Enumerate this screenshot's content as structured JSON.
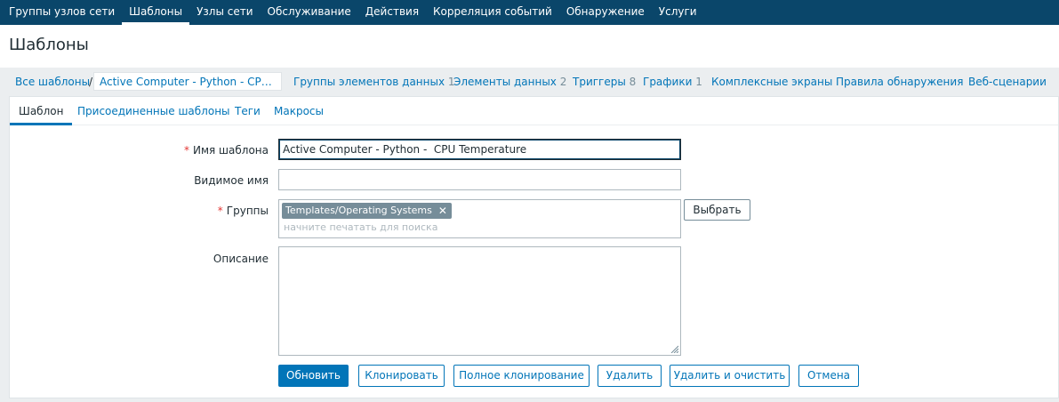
{
  "topnav": {
    "items": [
      {
        "label": "Группы узлов сети"
      },
      {
        "label": "Шаблоны"
      },
      {
        "label": "Узлы сети"
      },
      {
        "label": "Обслуживание"
      },
      {
        "label": "Действия"
      },
      {
        "label": "Корреляция событий"
      },
      {
        "label": "Обнаружение"
      },
      {
        "label": "Услуги"
      }
    ],
    "active": "Шаблоны"
  },
  "header": {
    "title": "Шаблоны"
  },
  "subnav": {
    "all_templates": "Все шаблоны",
    "separator": "/",
    "current_template": "Active Computer - Python - CPU Temperature",
    "links": [
      {
        "label": "Группы элементов данных",
        "count": "1"
      },
      {
        "label": "Элементы данных",
        "count": "2"
      },
      {
        "label": "Триггеры",
        "count": "8"
      },
      {
        "label": "Графики",
        "count": "1"
      },
      {
        "label": "Комплексные экраны",
        "count": ""
      },
      {
        "label": "Правила обнаружения",
        "count": ""
      },
      {
        "label": "Веб-сценарии",
        "count": ""
      }
    ]
  },
  "tabs": [
    {
      "label": "Шаблон"
    },
    {
      "label": "Присоединенные шаблоны"
    },
    {
      "label": "Теги"
    },
    {
      "label": "Макросы"
    }
  ],
  "form": {
    "required_mark": "*",
    "template_name_label": "Имя шаблона",
    "template_name_value": "Active Computer - Python -  CPU Temperature",
    "visible_name_label": "Видимое имя",
    "visible_name_value": "",
    "groups_label": "Группы",
    "groups_selected": [
      "Templates/Operating Systems"
    ],
    "groups_placeholder": "начните печатать для поиска",
    "select_button": "Выбрать",
    "description_label": "Описание",
    "description_value": ""
  },
  "buttons": {
    "update": "Обновить",
    "clone": "Клонировать",
    "full_clone": "Полное клонирование",
    "delete": "Удалить",
    "delete_clear": "Удалить и очистить",
    "cancel": "Отмена"
  },
  "colors": {
    "nav_bg": "#0a466a",
    "link": "#0275b8",
    "chip_bg": "#768d99",
    "required": "#e33734"
  },
  "icons": {
    "chip_remove": "close-icon",
    "resize": "resize-grip-icon"
  }
}
